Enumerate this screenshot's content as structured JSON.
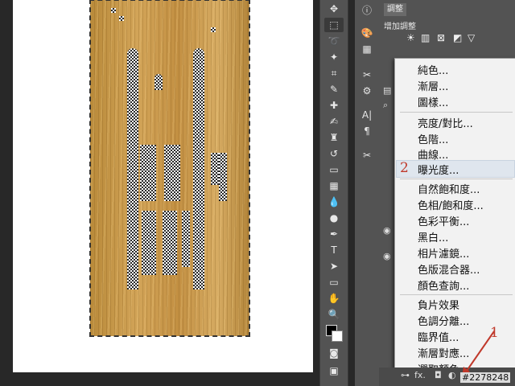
{
  "panel": {
    "tab_label": "調整",
    "subtitle": "增加調整"
  },
  "menu": {
    "items": [
      {
        "label": "純色..."
      },
      {
        "label": "漸層..."
      },
      {
        "label": "圖樣..."
      },
      {
        "label": "亮度/對比..."
      },
      {
        "label": "色階..."
      },
      {
        "label": "曲線..."
      },
      {
        "label": "曝光度..."
      },
      {
        "label": "自然飽和度..."
      },
      {
        "label": "色相/飽和度..."
      },
      {
        "label": "色彩平衡..."
      },
      {
        "label": "黑白..."
      },
      {
        "label": "相片濾鏡..."
      },
      {
        "label": "色版混合器..."
      },
      {
        "label": "顏色查詢..."
      },
      {
        "label": "負片效果"
      },
      {
        "label": "色調分離..."
      },
      {
        "label": "臨界值..."
      },
      {
        "label": "漸層對應..."
      },
      {
        "label": "選取顏色..."
      }
    ],
    "highlighted": "曝光度..."
  },
  "annotations": {
    "step1": "1",
    "step2": "2",
    "accent_color": "#c0392b"
  },
  "footer": {
    "image_id": "#2278248"
  },
  "icons": [
    "sun-icon",
    "brightness-icon",
    "curves-icon",
    "exposure-icon",
    "triangle-icon"
  ]
}
